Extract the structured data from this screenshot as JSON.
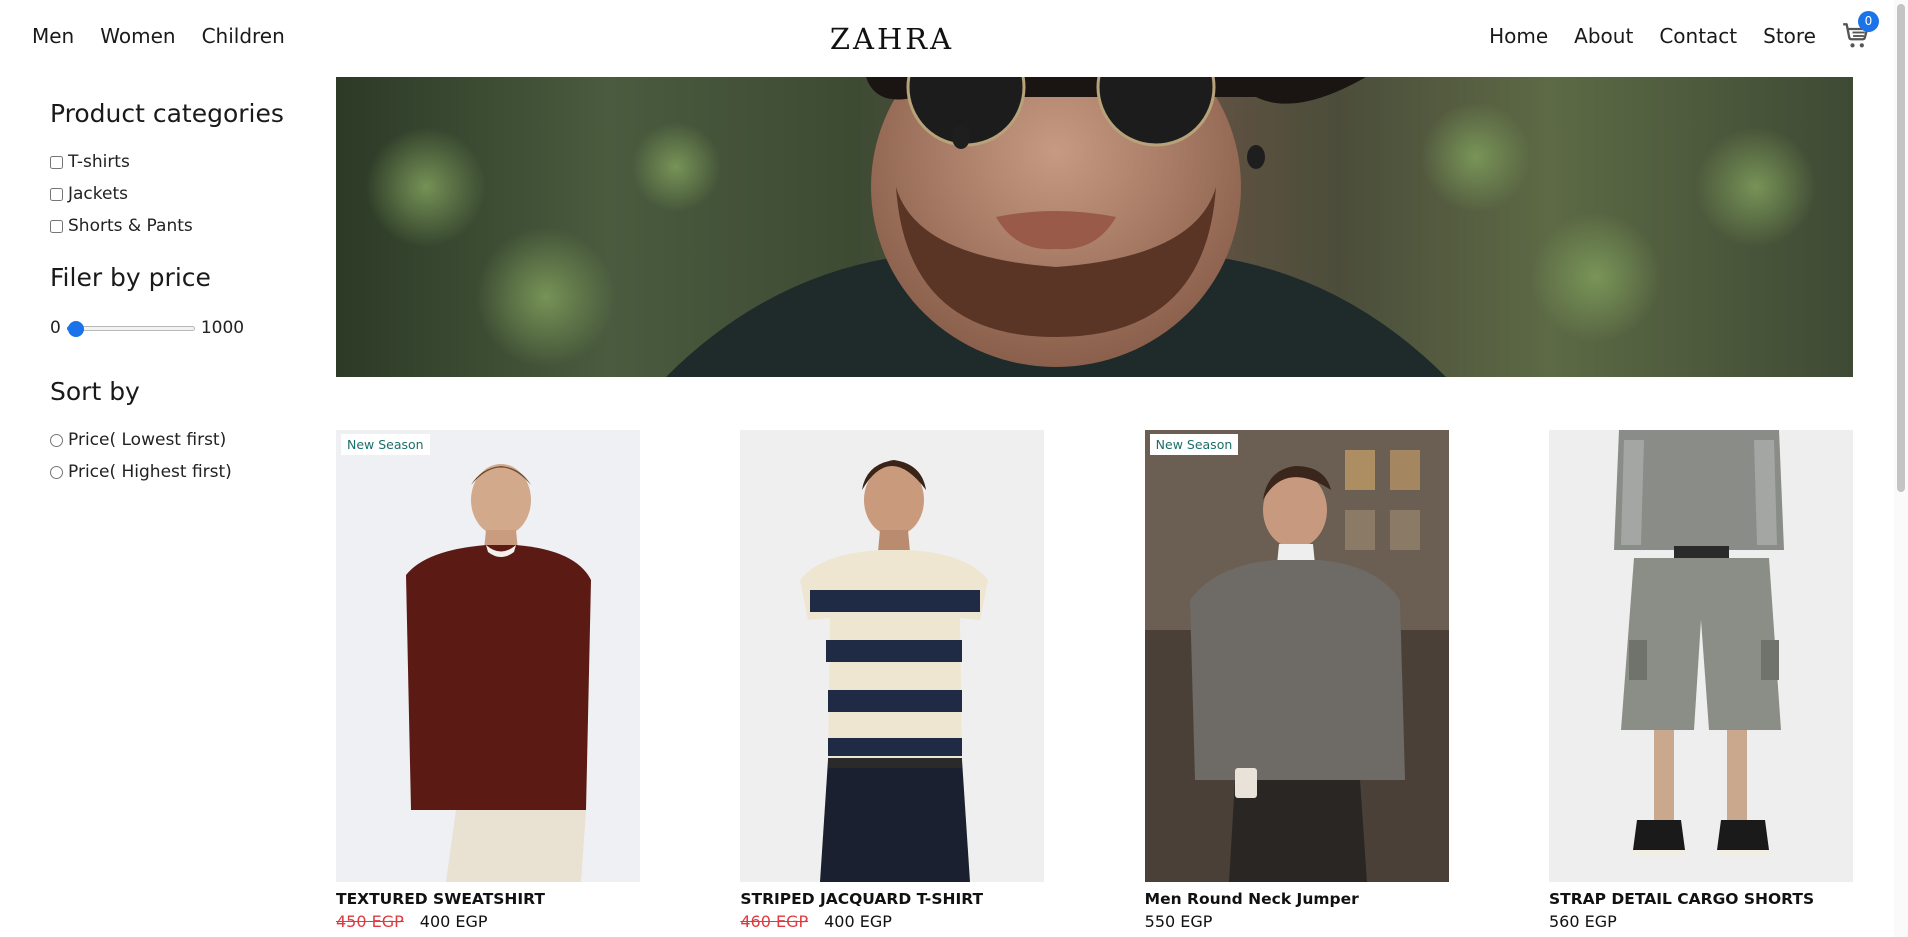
{
  "header": {
    "nav_left": [
      "Men",
      "Women",
      "Children"
    ],
    "logo": "ZAHRA",
    "nav_right": [
      "Home",
      "About",
      "Contact",
      "Store"
    ],
    "cart_count": "0"
  },
  "sidebar": {
    "categories_title": "Product categories",
    "categories": [
      "T-shirts",
      "Jackets",
      "Shorts & Pants"
    ],
    "price_title": "Filer by price",
    "price_min": "0",
    "price_max": "1000",
    "price_value_fraction": 0.07,
    "sort_title": "Sort by",
    "sort_options": [
      "Price( Lowest first)",
      "Price( Highest first)"
    ]
  },
  "products": [
    {
      "name": "TEXTURED SWEATSHIRT",
      "old_price": "450 EGP",
      "price": "400 EGP",
      "badge": "New Season"
    },
    {
      "name": "STRIPED JACQUARD T-SHIRT",
      "old_price": "460 EGP",
      "price": "400 EGP",
      "badge": ""
    },
    {
      "name": "Men Round Neck Jumper",
      "old_price": "",
      "price": "550 EGP",
      "badge": "New Season"
    },
    {
      "name": "STRAP DETAIL CARGO SHORTS",
      "old_price": "",
      "price": "560 EGP",
      "badge": ""
    }
  ],
  "colors": {
    "accent": "#1a73e8",
    "sale_price": "#e0393e",
    "badge_text": "#1b6f6a"
  }
}
